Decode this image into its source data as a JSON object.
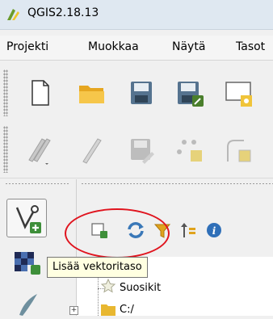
{
  "window": {
    "title": "QGIS2.18.13"
  },
  "menu": {
    "items": [
      "Projekti",
      "Muokkaa",
      "Näytä",
      "Tasot"
    ]
  },
  "toolbar1": {
    "icons": [
      "new-project-icon",
      "open-project-icon",
      "save-project-icon",
      "save-as-icon",
      "new-print-composer-icon"
    ]
  },
  "toolbar2": {
    "icons": [
      "digitize-icon",
      "toggle-editing-icon",
      "save-edits-icon",
      "add-point-icon",
      "node-tool-icon"
    ]
  },
  "left_toolbar": {
    "icons": [
      "add-vector-layer-icon",
      "add-raster-layer-icon",
      "add-delimited-text-icon"
    ]
  },
  "browser_toolbar": {
    "icons": [
      "add-layer-icon",
      "refresh-icon",
      "filter-icon",
      "collapse-all-icon",
      "properties-icon"
    ]
  },
  "tooltip": {
    "text": "Lisää vektoritaso"
  },
  "browser_tree": {
    "items": [
      {
        "label": "Suosikit"
      },
      {
        "label": "C:/"
      }
    ]
  },
  "colors": {
    "annotation_red": "#e0141e",
    "tooltip_bg": "#ffffe1"
  }
}
